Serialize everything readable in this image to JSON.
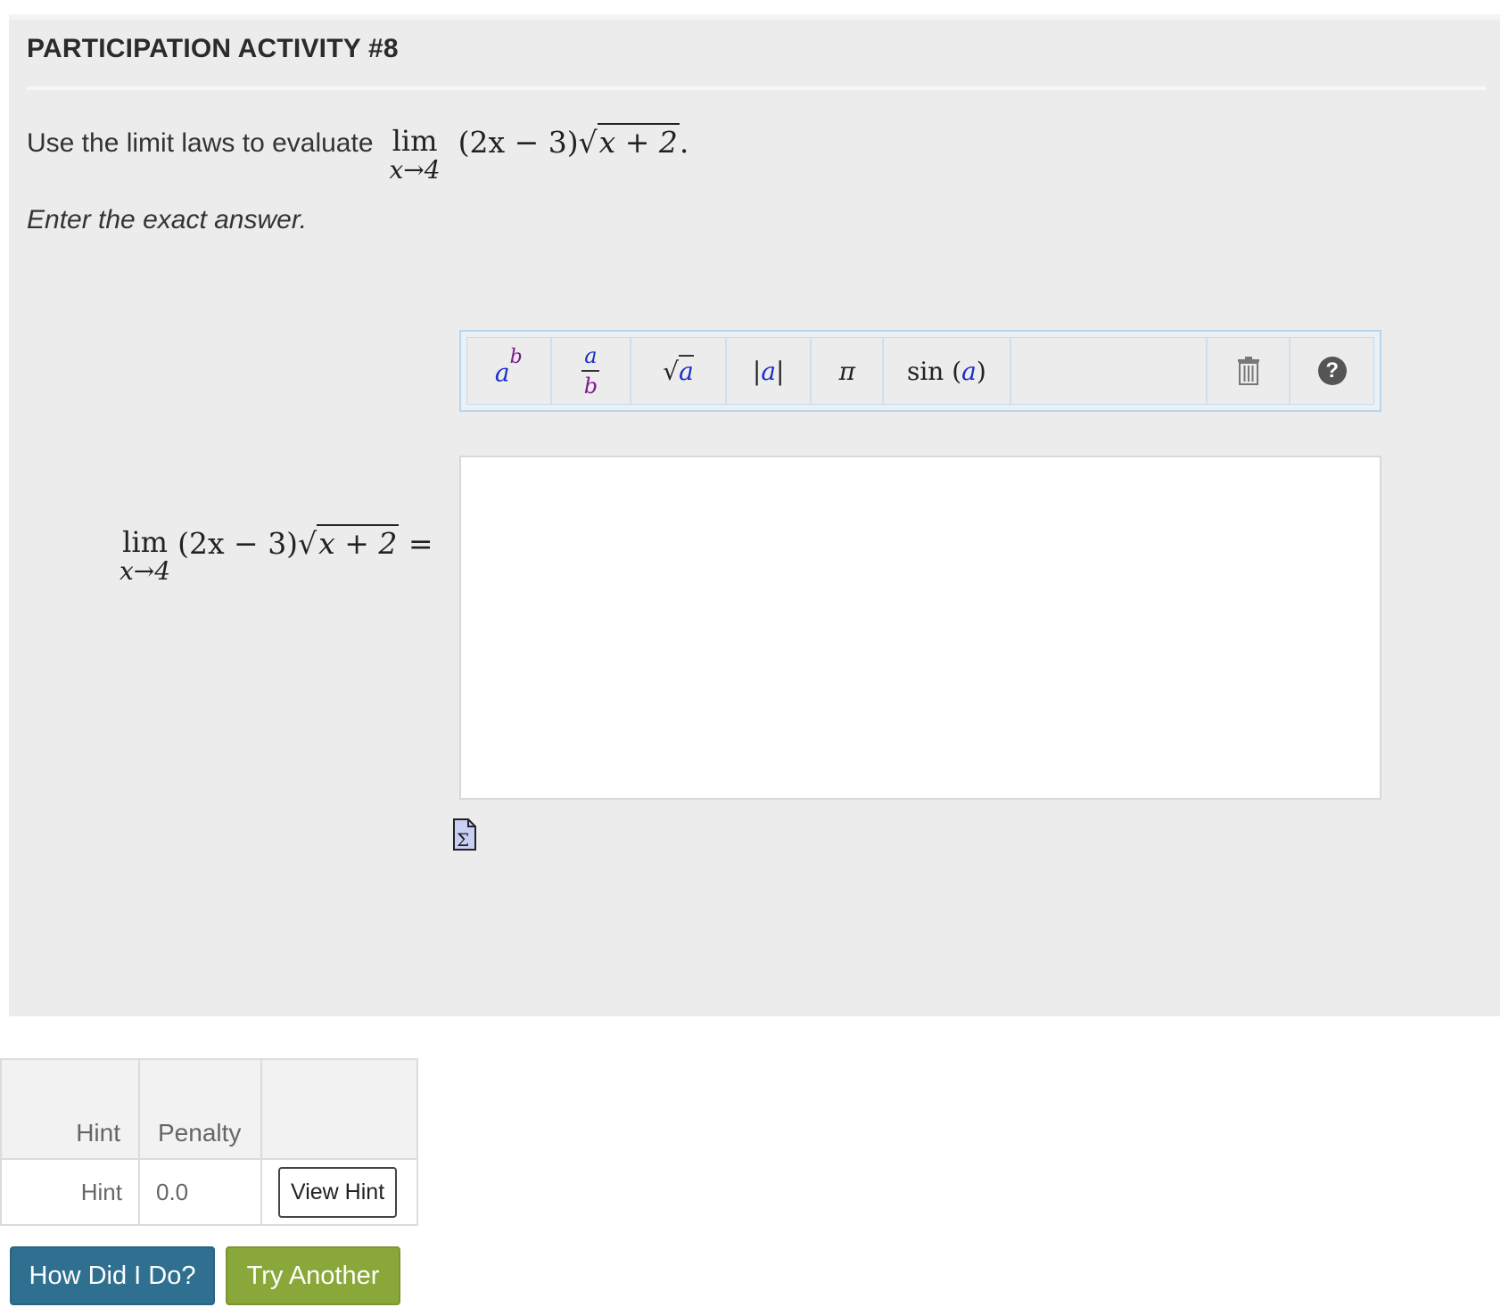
{
  "activity": {
    "title": "PARTICIPATION ACTIVITY #8"
  },
  "question": {
    "prompt": "Use the limit laws to evaluate",
    "lim_word": "lim",
    "lim_sub": "x→4",
    "expr_prefix": "(2x − 3)",
    "radicand": "x + 2",
    "period": ".",
    "instruction": "Enter the exact answer."
  },
  "answer_row": {
    "equals": "="
  },
  "toolbar": {
    "power": {
      "base": "a",
      "exp": "b",
      "icon": "power-icon"
    },
    "fraction": {
      "num": "a",
      "den": "b",
      "icon": "fraction-icon"
    },
    "sqrt": {
      "symbol": "√",
      "arg": "a",
      "icon": "sqrt-icon"
    },
    "abs": {
      "left": "|",
      "arg": "a",
      "right": "|",
      "icon": "abs-icon"
    },
    "pi": {
      "symbol": "π",
      "icon": "pi-icon"
    },
    "sin": {
      "fn": "sin",
      "open": "(",
      "arg": "a",
      "close": ")",
      "icon": "sin-icon"
    },
    "trash_icon": "trash-icon",
    "help": {
      "symbol": "?",
      "icon": "help-icon"
    }
  },
  "editor_icon": "sigma-document-icon",
  "hints": {
    "headers": [
      "Hint",
      "Penalty",
      ""
    ],
    "rows": [
      {
        "hint": "Hint",
        "penalty": "0.0",
        "action": "View Hint"
      }
    ]
  },
  "buttons": {
    "check": "How Did I Do?",
    "another": "Try Another"
  },
  "colors": {
    "panel_bg": "#ececec",
    "check_btn": "#2f6f8f",
    "another_btn": "#8aa73a",
    "var_a": "#1a2ec8",
    "var_b": "#7a1e8c"
  }
}
